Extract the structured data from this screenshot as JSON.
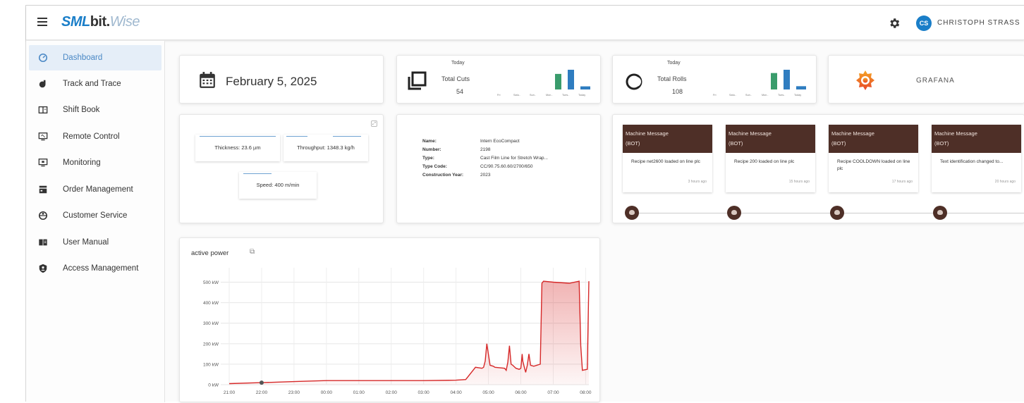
{
  "header": {
    "logo_sml": "SML",
    "logo_bit": "bit.",
    "logo_wise": "Wise",
    "avatar_initials": "CS",
    "user_name": "CHRISTOPH STRASS"
  },
  "sidebar": {
    "items": [
      {
        "label": "Dashboard",
        "active": true
      },
      {
        "label": "Track and Trace"
      },
      {
        "label": "Shift Book"
      },
      {
        "label": "Remote Control"
      },
      {
        "label": "Monitoring"
      },
      {
        "label": "Order Management"
      },
      {
        "label": "Customer Service"
      },
      {
        "label": "User Manual"
      },
      {
        "label": "Access Management"
      }
    ]
  },
  "date_card": {
    "date": "February 5, 2025"
  },
  "cuts_card": {
    "period": "Today",
    "label": "Total Cuts",
    "value": "54",
    "bar_values": [
      0,
      0,
      0,
      0,
      30,
      38,
      6
    ],
    "day_labels": [
      "Fri",
      "Satu..",
      "Sun..",
      "Mon..",
      "Tues..",
      "Today"
    ]
  },
  "rolls_card": {
    "period": "Today",
    "label": "Total Rolls",
    "value": "108",
    "bar_values": [
      0,
      0,
      0,
      0,
      25,
      30,
      5
    ],
    "day_labels": [
      "Fri",
      "Satu..",
      "Sun..",
      "Mon..",
      "Tues..",
      "Today"
    ]
  },
  "grafana_card": {
    "label": "GRAFANA"
  },
  "params_card": {
    "thickness": "Thickness: 23.6 µm",
    "throughput": "Throughput: 1348.3 kg/h",
    "speed": "Speed: 400 m/min"
  },
  "machine_card": {
    "rows": [
      {
        "key": "Name:",
        "value": "Intern EcoCompact"
      },
      {
        "key": "Number:",
        "value": "2198"
      },
      {
        "key": "Type:",
        "value": "Cast Film Line for Stretch Wrap..."
      },
      {
        "key": "Type Code:",
        "value": "CC/90.75.60.60/2700/650"
      },
      {
        "key": "Construction Year:",
        "value": "2023"
      }
    ]
  },
  "messages": [
    {
      "title": "Machine Message",
      "source": "(BOT)",
      "body": "Recipe net2600 loaded on line plc",
      "time": "3 hours ago"
    },
    {
      "title": "Machine Message",
      "source": "(BOT)",
      "body": "Recipe 200 loaded on line plc",
      "time": "15 hours ago"
    },
    {
      "title": "Machine Message",
      "source": "(BOT)",
      "body": "Recipe COOLDOWN loaded on line plc",
      "time": "17 hours ago"
    },
    {
      "title": "Machine Message",
      "source": "(BOT)",
      "body": "Text identification changed to...",
      "time": "20 hours ago"
    }
  ],
  "colors": {
    "brand_blue": "#1a7ec8",
    "message_header": "#4e2f27",
    "chart_line": "#d62828",
    "bar_green": "#3a9c6c",
    "bar_blue": "#2f7dc0"
  },
  "chart_data": {
    "type": "area",
    "title": "active power",
    "xlabel": "",
    "ylabel": "",
    "y_unit": "kW",
    "ylim": [
      0,
      550
    ],
    "y_ticks": [
      "0 kW",
      "100 kW",
      "200 kW",
      "300 kW",
      "400 kW",
      "500 kW"
    ],
    "x_ticks": [
      "21:00",
      "22:00",
      "23:00",
      "00:00",
      "01:00",
      "02:00",
      "03:00",
      "04:00",
      "05:00",
      "06:00",
      "07:00",
      "08:00"
    ],
    "grid": true,
    "series": [
      {
        "x": [
          0,
          1,
          2,
          3,
          4,
          5,
          6,
          7,
          7.3,
          7.6,
          7.8,
          7.85,
          7.9,
          7.95,
          8.05,
          8.15,
          8.2,
          8.5,
          8.55,
          8.6,
          8.65,
          8.7,
          8.75,
          8.85,
          8.95,
          9.0,
          9.02,
          9.04,
          9.06,
          9.1,
          9.15,
          9.2,
          9.25,
          9.3,
          9.4,
          9.6,
          9.65,
          9.7,
          10.0,
          10.5,
          10.8,
          10.85,
          10.9,
          11.05,
          11.1
        ],
        "y": [
          5,
          10,
          15,
          20,
          20,
          20,
          20,
          22,
          25,
          85,
          80,
          85,
          115,
          200,
          95,
          90,
          85,
          80,
          70,
          110,
          190,
          100,
          95,
          80,
          75,
          80,
          110,
          150,
          115,
          90,
          60,
          95,
          150,
          95,
          90,
          100,
          495,
          505,
          500,
          495,
          505,
          190,
          70,
          75,
          505
        ]
      }
    ]
  }
}
